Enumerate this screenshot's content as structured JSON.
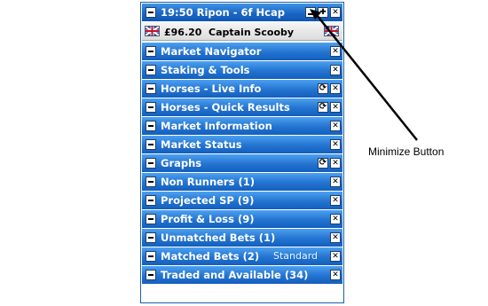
{
  "title_bar": {
    "text": "19:50  Ripon - 6f Hcap"
  },
  "info_bar": {
    "price": "£96.20",
    "selection": "Captain Scooby"
  },
  "sections": [
    {
      "label": "Market Navigator",
      "refresh": false,
      "extra": ""
    },
    {
      "label": "Staking & Tools",
      "refresh": false,
      "extra": ""
    },
    {
      "label": "Horses - Live Info",
      "refresh": true,
      "extra": ""
    },
    {
      "label": "Horses - Quick Results",
      "refresh": true,
      "extra": ""
    },
    {
      "label": "Market Information",
      "refresh": false,
      "extra": ""
    },
    {
      "label": "Market Status",
      "refresh": false,
      "extra": ""
    },
    {
      "label": "Graphs",
      "refresh": true,
      "extra": ""
    },
    {
      "label": "Non Runners (1)",
      "refresh": false,
      "extra": ""
    },
    {
      "label": "Projected SP (9)",
      "refresh": false,
      "extra": ""
    },
    {
      "label": "Profit & Loss (9)",
      "refresh": false,
      "extra": ""
    },
    {
      "label": "Unmatched Bets (1)",
      "refresh": false,
      "extra": ""
    },
    {
      "label": "Matched Bets (2)",
      "refresh": false,
      "extra": "Standard"
    },
    {
      "label": "Traded and Available (34)",
      "refresh": false,
      "extra": ""
    }
  ],
  "annotation": {
    "text": "Minimize Button"
  },
  "colors": {
    "header_blue": "#1a66c4",
    "border": "#1b5fa8"
  },
  "icons": [
    "collapse-icon",
    "minimize-icon",
    "restore-icon",
    "close-icon",
    "refresh-icon",
    "uk-flag-icon"
  ]
}
